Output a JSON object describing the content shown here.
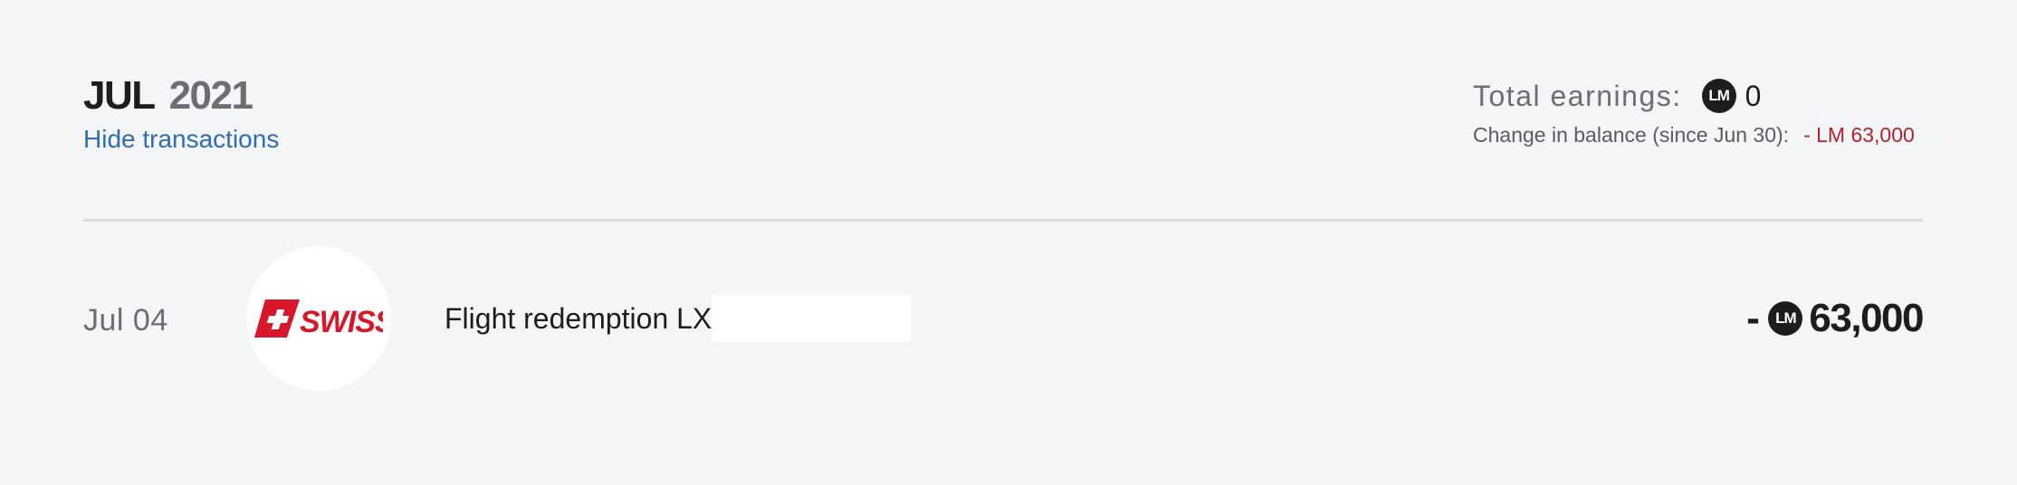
{
  "header": {
    "month": "JUL",
    "year": "2021",
    "toggle_label": "Hide transactions"
  },
  "summary": {
    "total_earnings_label": "Total earnings:",
    "currency_badge": "LM",
    "total_earnings_value": "0",
    "balance_change_label": "Change in balance (since Jun 30):",
    "balance_change_value": "- LM 63,000"
  },
  "transactions": [
    {
      "date": "Jul 04",
      "partner_logo": "SWISS",
      "partner_icon": "swiss-airlines-logo",
      "description": "Flight redemption LX",
      "sign": "-",
      "currency_badge": "LM",
      "amount": "63,000"
    }
  ],
  "colors": {
    "background": "#f4f5f7",
    "link": "#2f6db1",
    "negative": "#b3232f",
    "swiss_red": "#d8182a"
  }
}
